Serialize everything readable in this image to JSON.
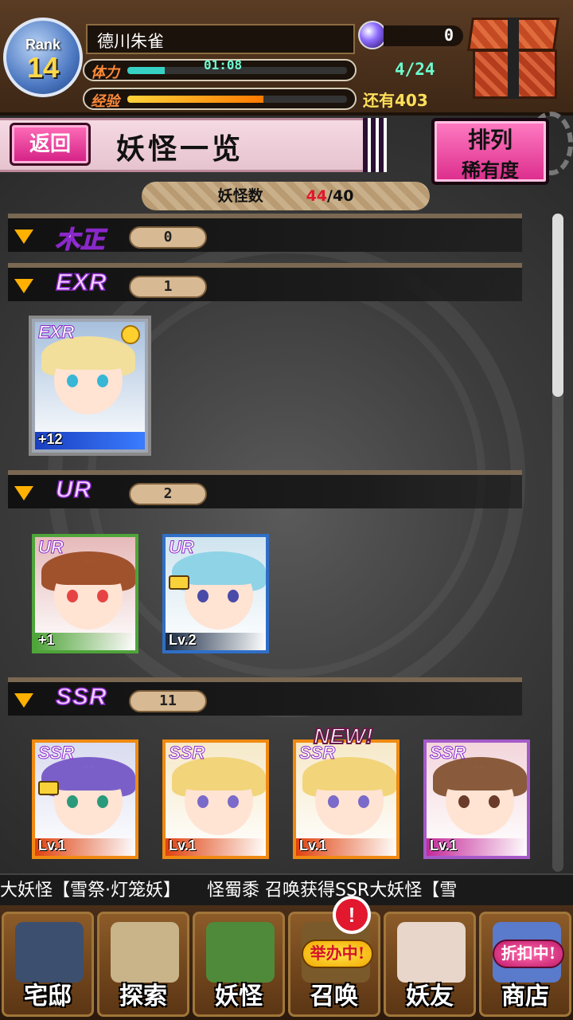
{
  "header": {
    "rank_label": "Rank",
    "rank_value": "14",
    "player_name": "德川朱雀",
    "gems": "0",
    "stamina_label": "体力",
    "stamina_timer": "01:08",
    "stamina_count": "4/24",
    "stamina_fill": 0.17,
    "exp_label": "经验",
    "exp_remaining": "还有403",
    "exp_fill": 0.62
  },
  "title": {
    "back_label": "返回",
    "page_title": "妖怪一览",
    "sort_line1": "排列",
    "sort_line2": "稀有度"
  },
  "count": {
    "label": "妖怪数",
    "current": "44",
    "max": "/40"
  },
  "sections": [
    {
      "rarity": "木正",
      "count": "0",
      "cards": []
    },
    {
      "rarity": "EXR",
      "count": "1",
      "cards": [
        {
          "rarity": "EXR",
          "level_text": "+12",
          "hair": "#f1df9b",
          "eye": "#37b6d6",
          "frame": "#9fa7b4",
          "bg": "#a7c0dd",
          "medal": true
        }
      ]
    },
    {
      "rarity": "UR",
      "count": "2",
      "cards": [
        {
          "rarity": "UR",
          "level_text": "+1",
          "hair": "#a0522d",
          "eye": "#e64444",
          "frame": "#4fa43a",
          "bg": "#e6b9b9",
          "foot": "#4fa43a"
        },
        {
          "rarity": "UR",
          "level_text": "Lv.2",
          "hair": "#8fd3e6",
          "eye": "#4a4aa8",
          "frame": "#2f6fc7",
          "bg": "#cfe4ef",
          "foot": "#1a2a44",
          "lock": true
        }
      ]
    },
    {
      "rarity": "SSR",
      "count": "11",
      "cards": [
        {
          "rarity": "SSR",
          "level_text": "Lv.1",
          "hair": "#7b5fc9",
          "eye": "#2a9a7a",
          "frame": "#f08a12",
          "bg": "#d9dcef",
          "foot": "#e04210",
          "lock": true
        },
        {
          "rarity": "SSR",
          "level_text": "Lv.1",
          "hair": "#f2d47a",
          "eye": "#7a6ac9",
          "frame": "#f08a12",
          "bg": "#f6e9c9",
          "foot": "#e04210"
        },
        {
          "rarity": "SSR",
          "level_text": "Lv.1",
          "hair": "#f2d47a",
          "eye": "#7a6ac9",
          "frame": "#f08a12",
          "bg": "#f6e9c9",
          "foot": "#e04210",
          "new": "NEW!"
        },
        {
          "rarity": "SSR",
          "level_text": "Lv.1",
          "hair": "#8a5a3c",
          "eye": "#6a3a2a",
          "frame": "#a65ac9",
          "bg": "#f3d6dc",
          "foot": "#c42a9a"
        }
      ]
    }
  ],
  "ticker": "大妖怪【雪祭·灯笼妖】　　怪蜀黍 召唤获得SSR大妖怪【雪",
  "nav": [
    {
      "label": "宅邸",
      "color": "#3d4f6e"
    },
    {
      "label": "探索",
      "color": "#c9b48a"
    },
    {
      "label": "妖怪",
      "color": "#4f8a3a"
    },
    {
      "label": "召唤",
      "color": "#7a5a2a",
      "badge": "举办中!"
    },
    {
      "label": "妖友",
      "color": "#e7d6c9"
    },
    {
      "label": "商店",
      "color": "#5a7acb",
      "badge": "折扣中!",
      "badge_pink": true
    }
  ],
  "alert": "!"
}
